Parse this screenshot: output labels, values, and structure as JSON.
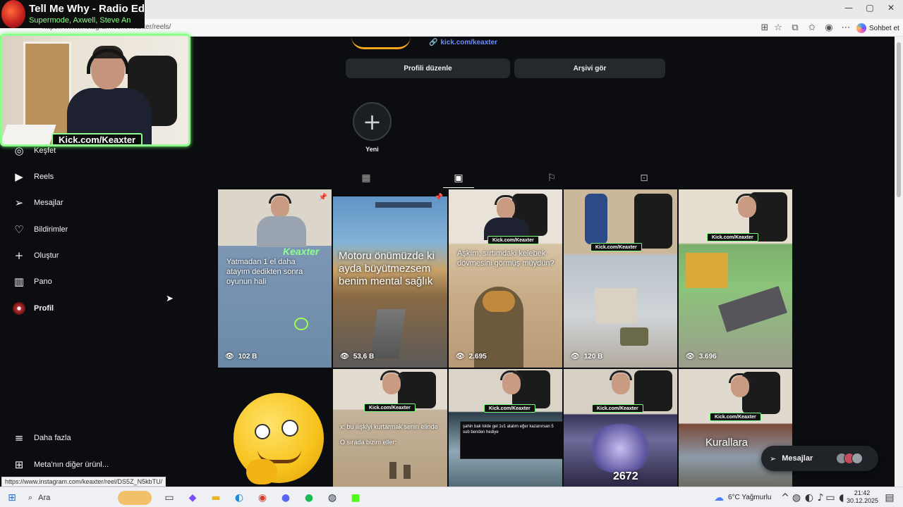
{
  "browser": {
    "url": "https://www.instagram.com/keaxter/reels/",
    "copilot_label": "Sohbet et",
    "window_controls": [
      "—",
      "▢",
      "✕"
    ]
  },
  "now_playing": {
    "title": "Tell Me Why - Radio Ed",
    "artists": "Supermode, Axwell, Steve An"
  },
  "webcam": {
    "tag": "Kick.com/Keaxter"
  },
  "sidebar": {
    "items": [
      {
        "label": "Keşfet",
        "icon": "compass-icon"
      },
      {
        "label": "Reels",
        "icon": "reels-icon"
      },
      {
        "label": "Mesajlar",
        "icon": "messages-icon"
      },
      {
        "label": "Bildirimler",
        "icon": "heart-icon"
      },
      {
        "label": "Oluştur",
        "icon": "plus-icon"
      },
      {
        "label": "Pano",
        "icon": "dashboard-icon"
      },
      {
        "label": "Profil",
        "icon": "profile-avatar"
      }
    ],
    "bottom": [
      {
        "label": "Daha fazla",
        "icon": "menu-icon"
      },
      {
        "label": "Meta'nın diğer ürünl...",
        "icon": "meta-icon"
      }
    ]
  },
  "profile": {
    "link": "kick.com/keaxter",
    "edit_button": "Profili düzenle",
    "archive_button": "Arşivi gör",
    "new_story": "Yeni"
  },
  "tabs": [
    {
      "icon": "grid-icon",
      "active": false
    },
    {
      "icon": "reels-tab-icon",
      "active": true
    },
    {
      "icon": "saved-icon",
      "active": false
    },
    {
      "icon": "tagged-icon",
      "active": false
    }
  ],
  "reels": [
    {
      "caption": "Yatmadan 1 el daha atayım dedikten sonra oyunun hali",
      "views": "102 B",
      "pinned": true,
      "tag": "Keaxter"
    },
    {
      "caption": "Motoru önümüzde ki ayda büyütmezsem benim mental sağlık",
      "views": "53,6 B",
      "pinned": true,
      "tag": ""
    },
    {
      "caption": "Aşkım, sırtımdaki kelebek dövmesini görmüş müydün?",
      "views": "2.695",
      "pinned": false,
      "tag": "Kick.com/Keaxter"
    },
    {
      "caption": "",
      "views": "120 B",
      "pinned": false,
      "tag": "Kick.com/Keaxter"
    },
    {
      "caption": "",
      "views": "3.696",
      "pinned": false,
      "tag": "Kick.com/Keaxter"
    },
    {
      "caption": "",
      "views": "",
      "pinned": false,
      "tag": ""
    },
    {
      "caption": "x: bu ilişkiyi kurtarmak senin elinde",
      "caption2": "O sırada bizim eller:",
      "views": "",
      "pinned": false,
      "tag": "Kick.com/Keaxter"
    },
    {
      "caption": "şahin bak lolde gel 1v1 atalım eğer kazanırsan 5 sub benden hediye",
      "views": "",
      "pinned": false,
      "tag": "Kick.com/Keaxter"
    },
    {
      "caption": "",
      "overlay_number": "2672",
      "views": "",
      "pinned": false,
      "tag": "Kick.com/Keaxter"
    },
    {
      "caption": "Kurallara",
      "views": "",
      "pinned": false,
      "tag": "Kick.com/Keaxter"
    }
  ],
  "messages_pill": {
    "label": "Mesajlar"
  },
  "status_url": "https://www.instagram.com/keaxter/reel/DS5Z_N5kbTU/",
  "taskbar": {
    "search": "Ara",
    "weather": "6°C Yağmurlu",
    "time": "21:42",
    "date": "30.12.2025"
  },
  "colors": {
    "page_bg": "#0b0d10",
    "button_bg": "#25292e",
    "link": "#6b8cff",
    "accent_green": "#8cff8c"
  }
}
